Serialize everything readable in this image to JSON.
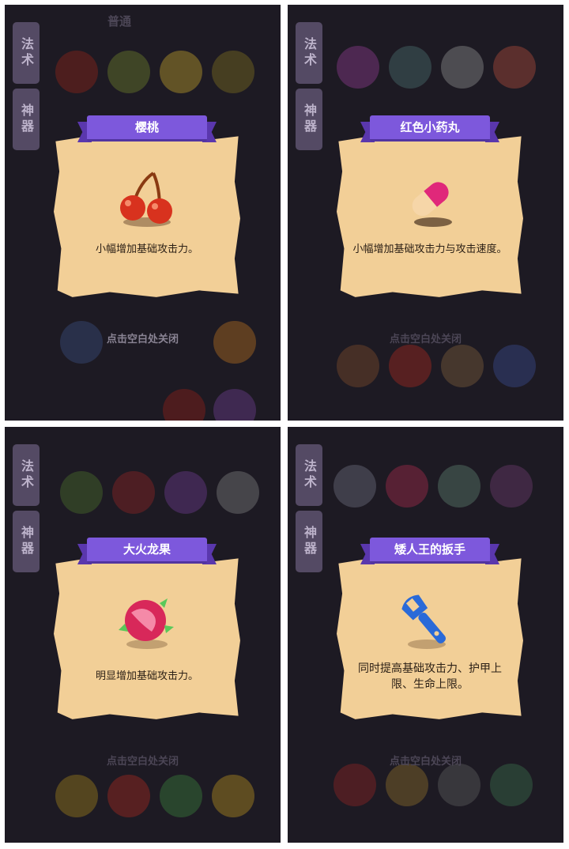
{
  "panels": [
    {
      "tabs": [
        "法术",
        "神器"
      ],
      "section_label": "普通",
      "title": "樱桃",
      "description": "小幅增加基础攻击力。",
      "hint": "点击空白处关闭",
      "icon": "cherry-icon"
    },
    {
      "tabs": [
        "法术",
        "神器"
      ],
      "title": "红色小药丸",
      "description": "小幅增加基础攻击力与攻击速度。",
      "hint": "点击空白处关闭",
      "icon": "pill-icon"
    },
    {
      "tabs": [
        "法术",
        "神器"
      ],
      "title": "大火龙果",
      "description": "明显增加基础攻击力。",
      "hint": "点击空白处关闭",
      "icon": "dragon-fruit-icon"
    },
    {
      "tabs": [
        "法术",
        "神器"
      ],
      "title": "矮人王的扳手",
      "description": "同时提高基础攻击力、护甲上限、生命上限。",
      "hint": "点击空白处关闭",
      "icon": "wrench-icon"
    }
  ],
  "colors": {
    "background": "#1d1a23",
    "ribbon": "#7d58dc",
    "scroll": "#f2cf97",
    "tab": "#544a64"
  }
}
